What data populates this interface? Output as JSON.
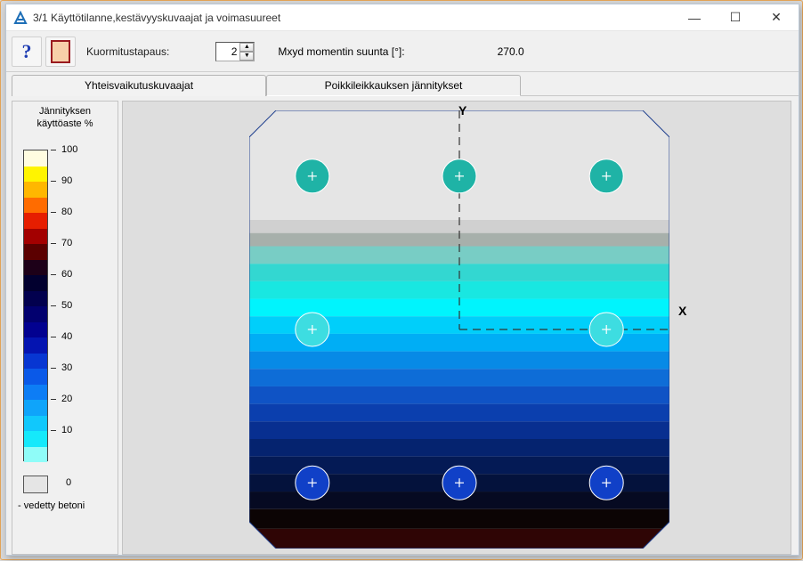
{
  "window": {
    "title": "3/1  Käyttötilanne,kestävyyskuvaajat ja voimasuureet",
    "ctrl_min": "—",
    "ctrl_max": "☐",
    "ctrl_close": "✕"
  },
  "toolbar": {
    "help_tooltip": "Ohje",
    "section_tooltip": "Poikkileikkaus",
    "load_case_label": "Kuormitustapaus:",
    "load_case_value": "2",
    "mxyd_label": "Mxyd momentin suunta [°]:",
    "mxyd_value": "270.0"
  },
  "tabs": {
    "t1": "Yhteisvaikutuskuvaajat",
    "t2": "Poikkileikkauksen jännitykset"
  },
  "legend": {
    "title_line1": "Jännityksen",
    "title_line2": "käyttöaste %",
    "ticks": [
      "100",
      "90",
      "80",
      "70",
      "60",
      "50",
      "40",
      "30",
      "20",
      "10"
    ],
    "zero_label": "0",
    "footer": "- vedetty betoni"
  },
  "axes": {
    "y": "Y",
    "x": "X"
  },
  "chart_data": {
    "type": "heatmap",
    "title": "Poikkileikkauksen jännitykset",
    "legend_title": "Jännityksen käyttöaste %",
    "y_axis_label": "Y",
    "x_axis_label": "X",
    "stress_bands": [
      {
        "y_from": 0.0,
        "y_to": 0.25,
        "utilization_pct": 0,
        "color": "#e5e5e5",
        "note": "vedetty betoni"
      },
      {
        "y_from": 0.25,
        "y_to": 0.28,
        "utilization_pct": 0,
        "color": "#d0d0d0"
      },
      {
        "y_from": 0.28,
        "y_to": 0.31,
        "utilization_pct": 0,
        "color": "#a7b0ab"
      },
      {
        "y_from": 0.31,
        "y_to": 0.35,
        "utilization_pct": 5,
        "color": "#78cdc5"
      },
      {
        "y_from": 0.35,
        "y_to": 0.39,
        "utilization_pct": 10,
        "color": "#33d7d1"
      },
      {
        "y_from": 0.39,
        "y_to": 0.43,
        "utilization_pct": 15,
        "color": "#19e7e1"
      },
      {
        "y_from": 0.43,
        "y_to": 0.47,
        "utilization_pct": 20,
        "color": "#00f4fd"
      },
      {
        "y_from": 0.47,
        "y_to": 0.51,
        "utilization_pct": 25,
        "color": "#00cffa"
      },
      {
        "y_from": 0.51,
        "y_to": 0.55,
        "utilization_pct": 30,
        "color": "#00aef5"
      },
      {
        "y_from": 0.55,
        "y_to": 0.59,
        "utilization_pct": 35,
        "color": "#078ae6"
      },
      {
        "y_from": 0.59,
        "y_to": 0.63,
        "utilization_pct": 40,
        "color": "#0e6dd7"
      },
      {
        "y_from": 0.63,
        "y_to": 0.67,
        "utilization_pct": 45,
        "color": "#0f53c5"
      },
      {
        "y_from": 0.67,
        "y_to": 0.71,
        "utilization_pct": 50,
        "color": "#0b3fae"
      },
      {
        "y_from": 0.71,
        "y_to": 0.75,
        "utilization_pct": 55,
        "color": "#082f90"
      },
      {
        "y_from": 0.75,
        "y_to": 0.79,
        "utilization_pct": 60,
        "color": "#05236f"
      },
      {
        "y_from": 0.79,
        "y_to": 0.83,
        "utilization_pct": 65,
        "color": "#041a55"
      },
      {
        "y_from": 0.83,
        "y_to": 0.87,
        "utilization_pct": 70,
        "color": "#04123c"
      },
      {
        "y_from": 0.87,
        "y_to": 0.91,
        "utilization_pct": 75,
        "color": "#060a22"
      },
      {
        "y_from": 0.91,
        "y_to": 0.955,
        "utilization_pct": 80,
        "color": "#0c0404"
      },
      {
        "y_from": 0.955,
        "y_to": 1.0,
        "utilization_pct": 85,
        "color": "#2f0505"
      }
    ],
    "rebar": [
      {
        "x": -0.35,
        "y": 0.35,
        "color_ring": "#1fb3a6"
      },
      {
        "x": 0.0,
        "y": 0.35,
        "color_ring": "#1fb3a6"
      },
      {
        "x": 0.35,
        "y": 0.35,
        "color_ring": "#1fb3a6"
      },
      {
        "x": -0.35,
        "y": 0.0,
        "color_ring": "#3ddde1"
      },
      {
        "x": 0.35,
        "y": 0.0,
        "color_ring": "#3ddde1"
      },
      {
        "x": -0.35,
        "y": -0.35,
        "color_ring": "#1040c7"
      },
      {
        "x": 0.0,
        "y": -0.35,
        "color_ring": "#1040c7"
      },
      {
        "x": 0.35,
        "y": -0.35,
        "color_ring": "#1040c7"
      }
    ],
    "colorbar": {
      "range": [
        0,
        100
      ],
      "ticks": [
        100,
        90,
        80,
        70,
        60,
        50,
        40,
        30,
        20,
        10
      ],
      "colors_top_to_bottom": [
        "#fffce0",
        "#fff400",
        "#ffb700",
        "#ff6c00",
        "#e61e00",
        "#a30000",
        "#5b0000",
        "#1d0018",
        "#02002f",
        "#02004e",
        "#02006f",
        "#020190",
        "#0414b1",
        "#0736d2",
        "#0a59e8",
        "#0d7df5",
        "#0fa4fa",
        "#11c8fc",
        "#15e9fb",
        "#8ffcf8"
      ]
    }
  }
}
